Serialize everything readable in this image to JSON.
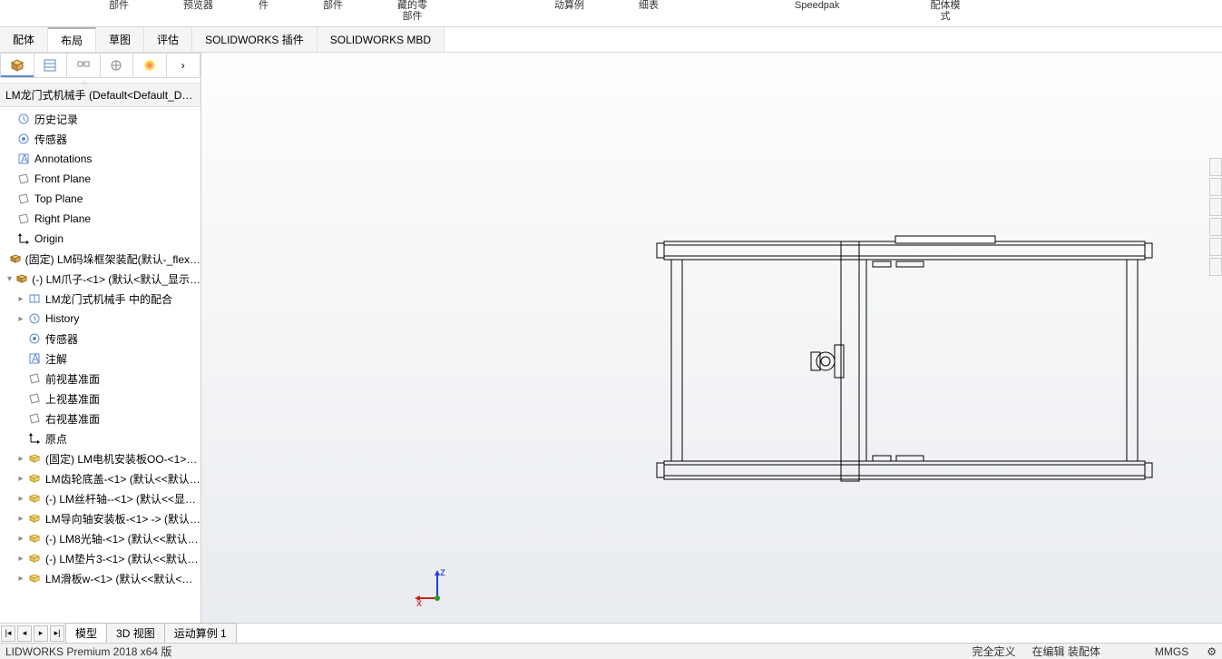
{
  "ribbon_labels": {
    "a": "部件",
    "b": "预览器",
    "c": "件",
    "d": "部件",
    "e": "藏的零\n部件",
    "f": "动算例",
    "g": "细表",
    "h": "Speedpak",
    "i": "配体模\n式"
  },
  "tabs": [
    "配体",
    "布局",
    "草图",
    "评估",
    "SOLIDWORKS 插件",
    "SOLIDWORKS MBD"
  ],
  "active_tab_index": 1,
  "tree_header": "LM龙门式机械手   (Default<Default_D…",
  "tree": [
    {
      "icon": "history",
      "label": "历史记录"
    },
    {
      "icon": "sensor",
      "label": "传感器"
    },
    {
      "icon": "annot",
      "label": "Annotations"
    },
    {
      "icon": "plane",
      "label": "Front Plane"
    },
    {
      "icon": "plane",
      "label": "Top Plane"
    },
    {
      "icon": "plane",
      "label": "Right Plane"
    },
    {
      "icon": "origin",
      "label": "Origin"
    },
    {
      "icon": "asm",
      "label": "(固定) LM码垛框架装配(默认-_flex…"
    },
    {
      "icon": "asm",
      "label": "(-) LM爪子-<1> (默认<默认_显示…",
      "expanded": true,
      "children": [
        {
          "icon": "mate",
          "label": "LM龙门式机械手 中的配合",
          "exp": true
        },
        {
          "icon": "history",
          "label": "History",
          "exp": true
        },
        {
          "icon": "sensor",
          "label": "传感器"
        },
        {
          "icon": "annot",
          "label": "注解"
        },
        {
          "icon": "plane",
          "label": "前视基准面"
        },
        {
          "icon": "plane",
          "label": "上视基准面"
        },
        {
          "icon": "plane",
          "label": "右视基准面"
        },
        {
          "icon": "origin",
          "label": "原点"
        },
        {
          "icon": "part",
          "label": "(固定) LM电机安装板OO-<1>…",
          "exp": true
        },
        {
          "icon": "part",
          "label": "LM齿轮底盖-<1> (默认<<默认…",
          "exp": true
        },
        {
          "icon": "part",
          "label": "(-) LM丝杆轴--<1> (默认<<显…",
          "exp": true
        },
        {
          "icon": "part",
          "label": "LM导向轴安装板-<1> -> (默认…",
          "exp": true
        },
        {
          "icon": "part",
          "label": "(-) LM8光轴-<1> (默认<<默认…",
          "exp": true
        },
        {
          "icon": "part",
          "label": "(-) LM垫片3-<1> (默认<<默认…",
          "exp": true
        },
        {
          "icon": "part",
          "label": "LM滑板w-<1> (默认<<默认<…",
          "exp": true
        }
      ]
    }
  ],
  "bottom_tabs": [
    "模型",
    "3D 视图",
    "运动算例 1"
  ],
  "active_bottom_tab": 0,
  "status": {
    "left": "LIDWORKS Premium 2018 x64 版",
    "a": "完全定义",
    "b": "在编辑 装配体",
    "c": "MMGS"
  },
  "triad": {
    "x": "x",
    "z": "z"
  }
}
